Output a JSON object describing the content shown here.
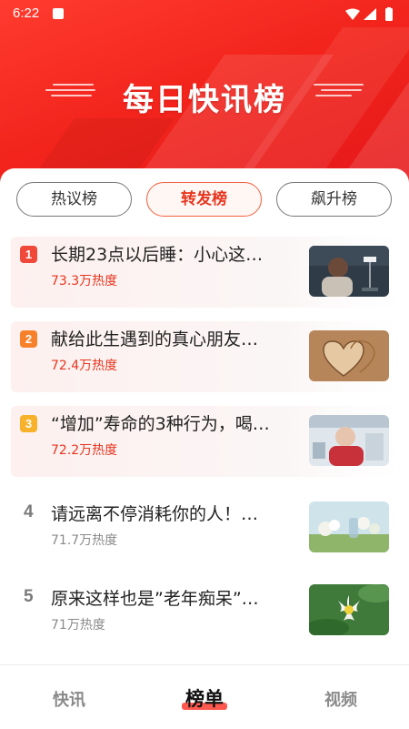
{
  "status_bar": {
    "time": "6:22"
  },
  "header": {
    "title": "每日快讯榜"
  },
  "tabs": [
    {
      "label": "热议榜",
      "active": false
    },
    {
      "label": "转发榜",
      "active": true
    },
    {
      "label": "飙升榜",
      "active": false
    }
  ],
  "ranking": [
    {
      "rank": "1",
      "title": "长期23点以后睡：小心这…",
      "heat": "73.3万热度",
      "badge_color": "#f0493a"
    },
    {
      "rank": "2",
      "title": "献给此生遇到的真心朋友…",
      "heat": "72.4万热度",
      "badge_color": "#f7812a"
    },
    {
      "rank": "3",
      "title": "“增加”寿命的3种行为，喝…",
      "heat": "72.2万热度",
      "badge_color": "#f7b12a"
    },
    {
      "rank": "4",
      "title": "请远离不停消耗你的人！…",
      "heat": "71.7万热度"
    },
    {
      "rank": "5",
      "title": "原来这样也是”老年痴呆”…",
      "heat": "71万热度"
    }
  ],
  "bottom_nav": [
    {
      "label": "快讯",
      "active": false
    },
    {
      "label": "榜单",
      "active": true
    },
    {
      "label": "视频",
      "active": false
    }
  ],
  "colors": {
    "accent": "#ef2a20",
    "heat_hot": "#e8361f",
    "heat_normal": "#8a8a8a"
  },
  "icons": [
    "app-notification-icon",
    "wifi-icon",
    "signal-icon",
    "battery-icon"
  ]
}
